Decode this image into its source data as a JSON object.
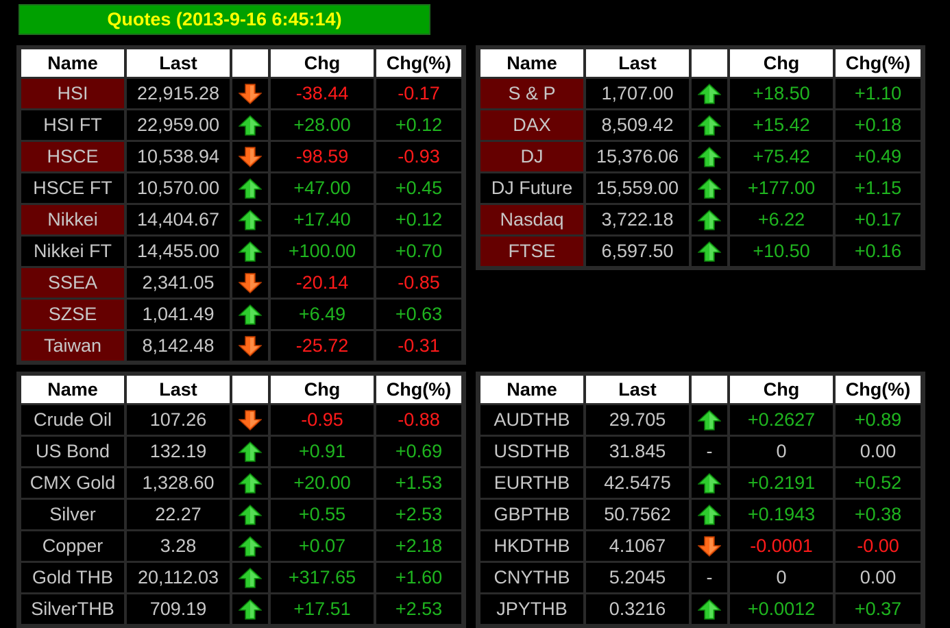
{
  "title": "Quotes (2013-9-16 6:45:14)",
  "headers": {
    "name": "Name",
    "last": "Last",
    "chg": "Chg",
    "pct": "Chg(%)"
  },
  "colors": {
    "up": "#1fb51f",
    "down": "#ff1a1a",
    "title_bg": "#00a000",
    "title_text": "#ffff00",
    "name_highlight": "#650000"
  },
  "panels": [
    {
      "id": "asia-indices",
      "rows": [
        {
          "name": "HSI",
          "last": "22,915.28",
          "dir": "down",
          "chg": "-38.44",
          "pct": "-0.17",
          "hl": true
        },
        {
          "name": "HSI FT",
          "last": "22,959.00",
          "dir": "up",
          "chg": "+28.00",
          "pct": "+0.12",
          "hl": false
        },
        {
          "name": "HSCE",
          "last": "10,538.94",
          "dir": "down",
          "chg": "-98.59",
          "pct": "-0.93",
          "hl": true
        },
        {
          "name": "HSCE FT",
          "last": "10,570.00",
          "dir": "up",
          "chg": "+47.00",
          "pct": "+0.45",
          "hl": false
        },
        {
          "name": "Nikkei",
          "last": "14,404.67",
          "dir": "up",
          "chg": "+17.40",
          "pct": "+0.12",
          "hl": true
        },
        {
          "name": "Nikkei FT",
          "last": "14,455.00",
          "dir": "up",
          "chg": "+100.00",
          "pct": "+0.70",
          "hl": false
        },
        {
          "name": "SSEA",
          "last": "2,341.05",
          "dir": "down",
          "chg": "-20.14",
          "pct": "-0.85",
          "hl": true
        },
        {
          "name": "SZSE",
          "last": "1,041.49",
          "dir": "up",
          "chg": "+6.49",
          "pct": "+0.63",
          "hl": true
        },
        {
          "name": "Taiwan",
          "last": "8,142.48",
          "dir": "down",
          "chg": "-25.72",
          "pct": "-0.31",
          "hl": true
        }
      ]
    },
    {
      "id": "west-indices",
      "rows": [
        {
          "name": "S & P",
          "last": "1,707.00",
          "dir": "up",
          "chg": "+18.50",
          "pct": "+1.10",
          "hl": true
        },
        {
          "name": "DAX",
          "last": "8,509.42",
          "dir": "up",
          "chg": "+15.42",
          "pct": "+0.18",
          "hl": true
        },
        {
          "name": "DJ",
          "last": "15,376.06",
          "dir": "up",
          "chg": "+75.42",
          "pct": "+0.49",
          "hl": true
        },
        {
          "name": "DJ Future",
          "last": "15,559.00",
          "dir": "up",
          "chg": "+177.00",
          "pct": "+1.15",
          "hl": false
        },
        {
          "name": "Nasdaq",
          "last": "3,722.18",
          "dir": "up",
          "chg": "+6.22",
          "pct": "+0.17",
          "hl": true
        },
        {
          "name": "FTSE",
          "last": "6,597.50",
          "dir": "up",
          "chg": "+10.50",
          "pct": "+0.16",
          "hl": true
        }
      ]
    },
    {
      "id": "commodities",
      "rows": [
        {
          "name": "Crude Oil",
          "last": "107.26",
          "dir": "down",
          "chg": "-0.95",
          "pct": "-0.88",
          "hl": false
        },
        {
          "name": "US Bond",
          "last": "132.19",
          "dir": "up",
          "chg": "+0.91",
          "pct": "+0.69",
          "hl": false
        },
        {
          "name": "CMX Gold",
          "last": "1,328.60",
          "dir": "up",
          "chg": "+20.00",
          "pct": "+1.53",
          "hl": false
        },
        {
          "name": "Silver",
          "last": "22.27",
          "dir": "up",
          "chg": "+0.55",
          "pct": "+2.53",
          "hl": false
        },
        {
          "name": "Copper",
          "last": "3.28",
          "dir": "up",
          "chg": "+0.07",
          "pct": "+2.18",
          "hl": false
        },
        {
          "name": "Gold THB",
          "last": "20,112.03",
          "dir": "up",
          "chg": "+317.65",
          "pct": "+1.60",
          "hl": false
        },
        {
          "name": "SilverTHB",
          "last": "709.19",
          "dir": "up",
          "chg": "+17.51",
          "pct": "+2.53",
          "hl": false
        }
      ]
    },
    {
      "id": "currencies",
      "rows": [
        {
          "name": "AUDTHB",
          "last": "29.705",
          "dir": "up",
          "chg": "+0.2627",
          "pct": "+0.89",
          "hl": false
        },
        {
          "name": "USDTHB",
          "last": "31.845",
          "dir": "flat",
          "flat_mark": "-",
          "chg": "0",
          "pct": "0.00",
          "hl": false
        },
        {
          "name": "EURTHB",
          "last": "42.5475",
          "dir": "up",
          "chg": "+0.2191",
          "pct": "+0.52",
          "hl": false
        },
        {
          "name": "GBPTHB",
          "last": "50.7562",
          "dir": "up",
          "chg": "+0.1943",
          "pct": "+0.38",
          "hl": false
        },
        {
          "name": "HKDTHB",
          "last": "4.1067",
          "dir": "down",
          "chg": "-0.0001",
          "pct": "-0.00",
          "hl": false
        },
        {
          "name": "CNYTHB",
          "last": "5.2045",
          "dir": "flat",
          "flat_mark": "-",
          "chg": "0",
          "pct": "0.00",
          "hl": false
        },
        {
          "name": "JPYTHB",
          "last": "0.3216",
          "dir": "up",
          "chg": "+0.0012",
          "pct": "+0.37",
          "hl": false
        }
      ]
    }
  ]
}
